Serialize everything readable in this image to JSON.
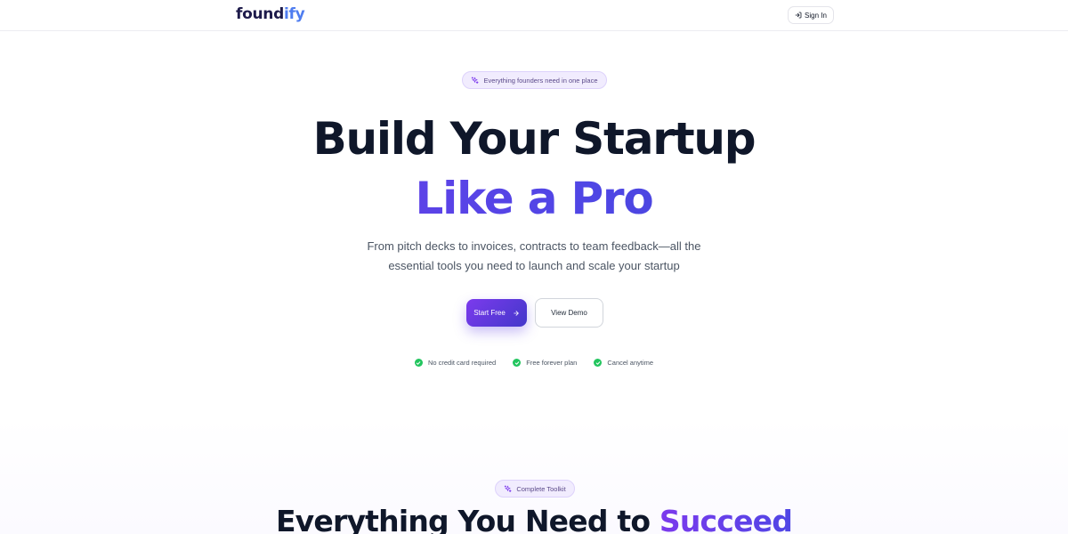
{
  "header": {
    "logo_part1": "found",
    "logo_part2": "ify",
    "signin_label": "Sign In"
  },
  "hero": {
    "badge": "Everything founders need in one place",
    "title_line1": "Build Your Startup",
    "title_line2": "Like a Pro",
    "subtitle_line1": "From pitch decks to invoices, contracts to team feedback—all the",
    "subtitle_line2": "essential tools you need to launch and scale your startup",
    "primary_cta": "Start Free",
    "secondary_cta": "View Demo",
    "benefits": [
      "No credit card required",
      "Free forever plan",
      "Cancel anytime"
    ]
  },
  "features": {
    "badge": "Complete Toolkit",
    "title_part1": "Everything You Need to ",
    "title_part2": "Succeed"
  },
  "icons": {
    "signin": "log-in-icon",
    "sparkles": "sparkles-icon",
    "arrow": "arrow-right-icon",
    "check": "check-circle-icon"
  },
  "colors": {
    "brand_dark": "#1e1b4b",
    "brand_blue": "#4f7df0",
    "accent_purple": "#7c3aed",
    "accent_indigo": "#4338ca",
    "success_green": "#22c55e"
  }
}
